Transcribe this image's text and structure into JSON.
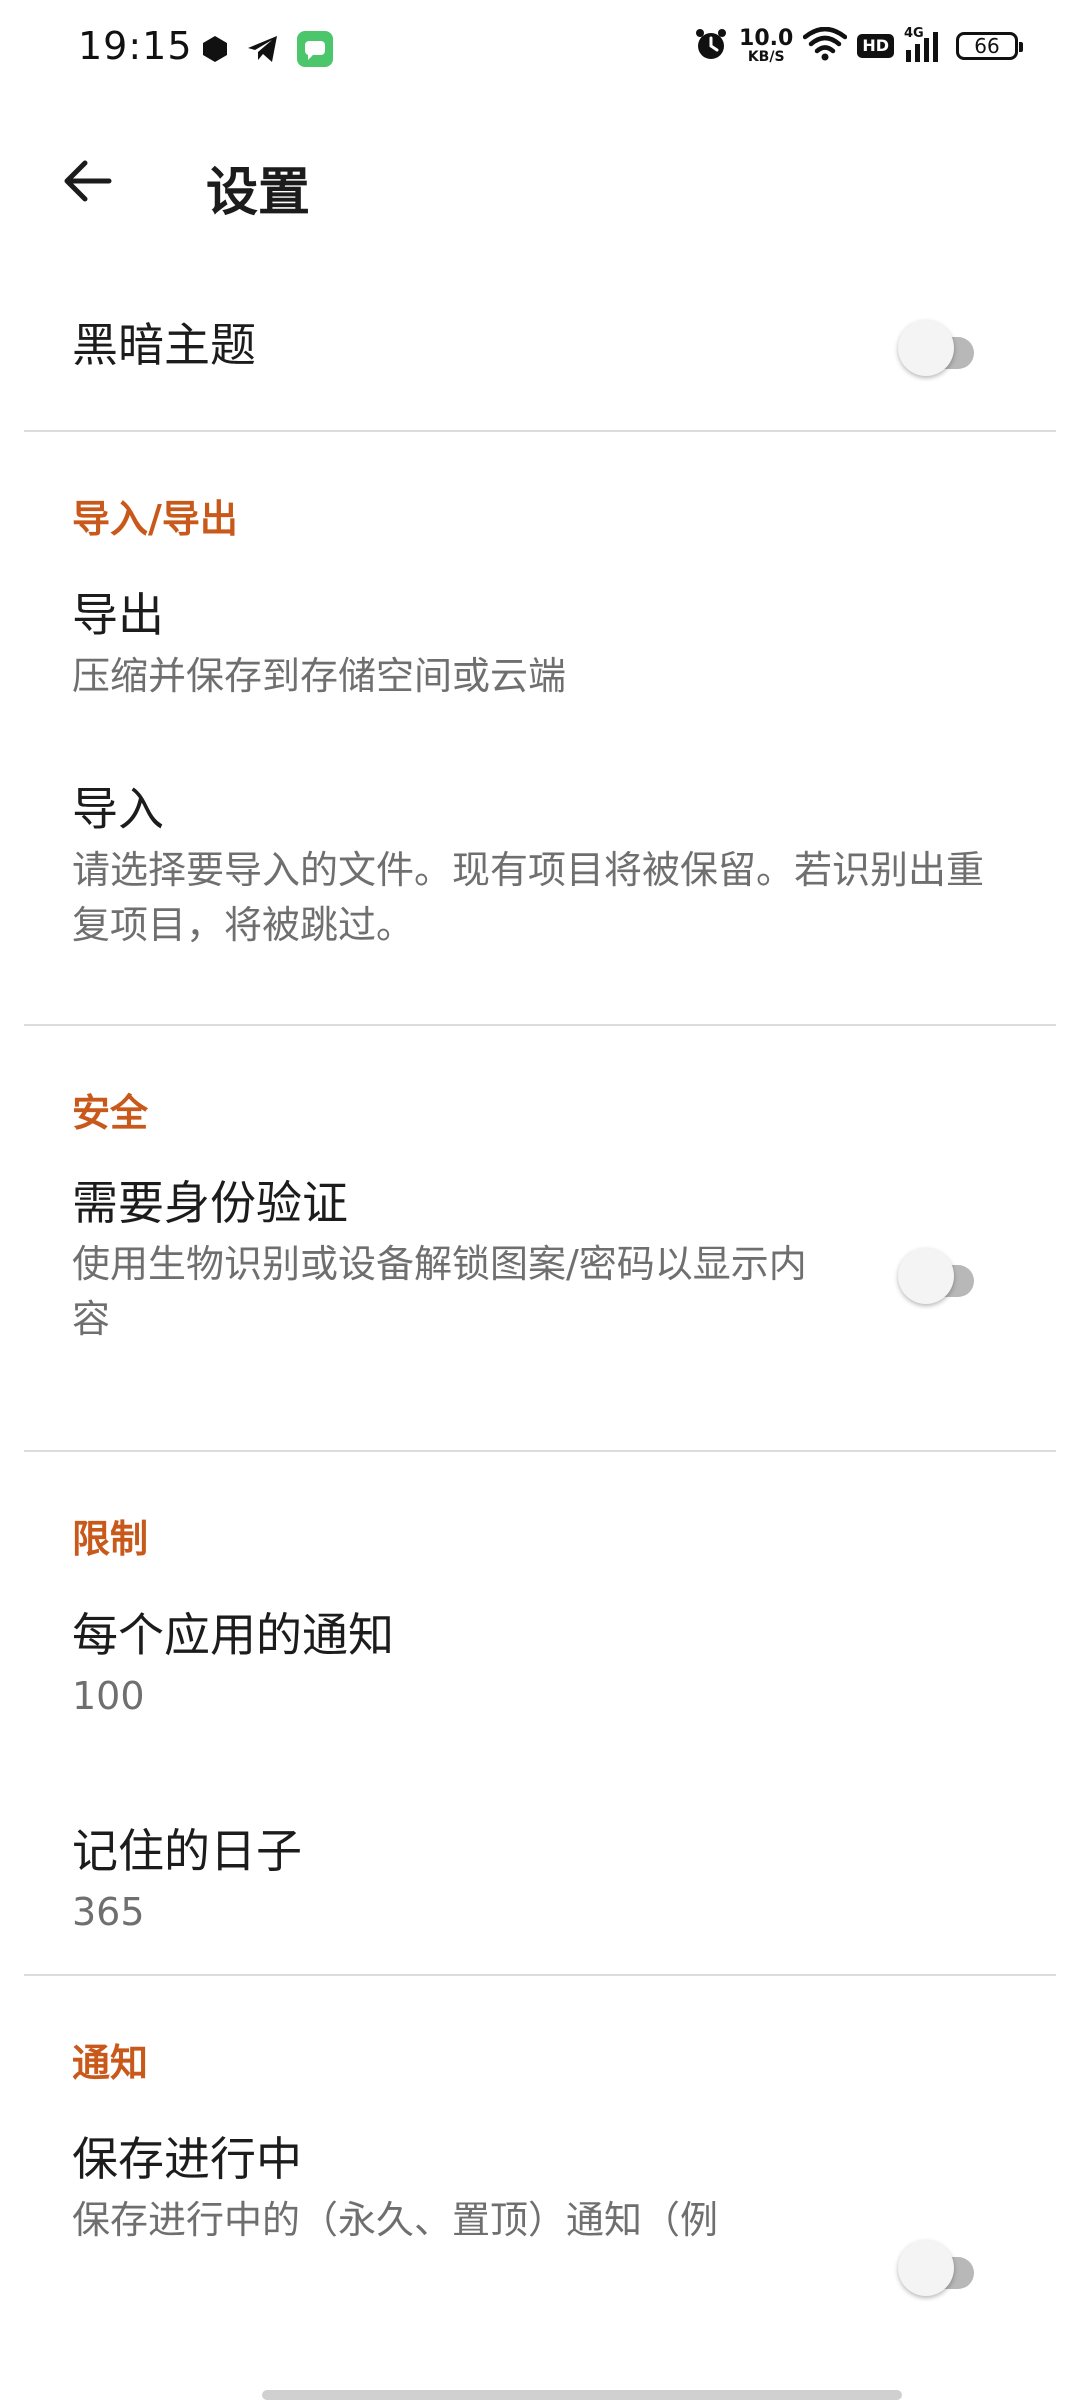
{
  "status_bar": {
    "time": "19:15",
    "speed_value": "10.0",
    "speed_unit": "KB/S",
    "hd_label": "HD",
    "network_label": "4G",
    "battery_level": "66"
  },
  "app_bar": {
    "title": "设置",
    "back_icon": "arrow-left-icon"
  },
  "settings": {
    "dark_theme": {
      "title": "黑暗主题",
      "enabled": false
    },
    "import_export": {
      "category": "导入/导出",
      "export": {
        "title": "导出",
        "summary": "压缩并保存到存储空间或云端"
      },
      "import": {
        "title": "导入",
        "summary": "请选择要导入的文件。现有项目将被保留。若识别出重复项目，将被跳过。"
      }
    },
    "security": {
      "category": "安全",
      "auth": {
        "title": "需要身份验证",
        "summary": "使用生物识别或设备解锁图案/密码以显示内容",
        "enabled": false
      }
    },
    "limits": {
      "category": "限制",
      "per_app": {
        "title": "每个应用的通知",
        "value": "100"
      },
      "remember_days": {
        "title": "记住的日子",
        "value": "365"
      }
    },
    "notifications": {
      "category": "通知",
      "save_ongoing": {
        "title": "保存进行中",
        "summary": "保存进行中的（永久、置顶）通知（例",
        "enabled": false
      }
    }
  },
  "colors": {
    "accent": "#c9591a",
    "switch_track_off": "#b8b8b8",
    "divider": "#dcdcdc"
  }
}
